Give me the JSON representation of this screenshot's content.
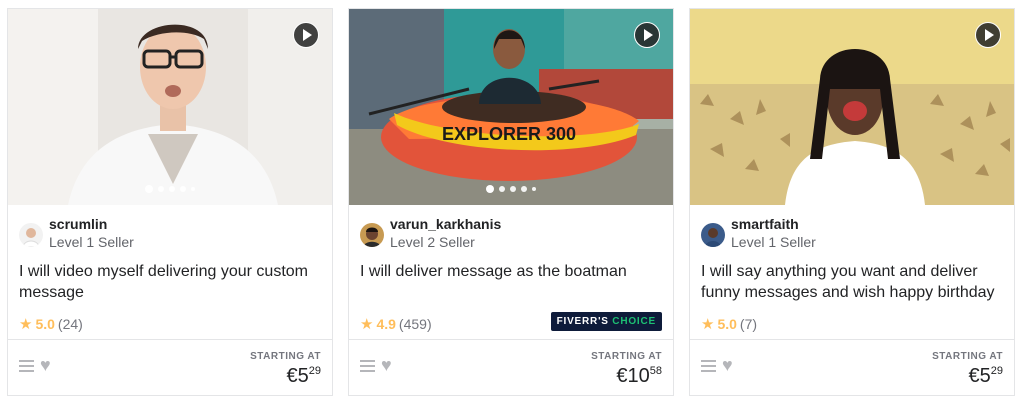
{
  "cards": [
    {
      "seller": "scrumlin",
      "level": "Level 1 Seller",
      "title": "I will video myself delivering your custom message",
      "rating": "5.0",
      "reviews": "(24)",
      "starting_at": "STARTING AT",
      "price_main": "€5",
      "price_cents": "29",
      "badge": ""
    },
    {
      "seller": "varun_karkhanis",
      "level": "Level 2 Seller",
      "title": "I will deliver message as the boatman",
      "rating": "4.9",
      "reviews": "(459)",
      "starting_at": "STARTING AT",
      "price_main": "€10",
      "price_cents": "58",
      "badge_part1": "FIVERR'S ",
      "badge_part2": "CHOICE",
      "boat_text": "EXPLORER 300"
    },
    {
      "seller": "smartfaith",
      "level": "Level 1 Seller",
      "title": "I will say anything you want and deliver funny messages and wish happy birthday",
      "rating": "5.0",
      "reviews": "(7)",
      "starting_at": "STARTING AT",
      "price_main": "€5",
      "price_cents": "29",
      "badge": ""
    }
  ],
  "colors": {
    "star": "#ffbe5b",
    "badge_bg": "#0e1b3a",
    "badge_accent": "#1dbf73"
  }
}
